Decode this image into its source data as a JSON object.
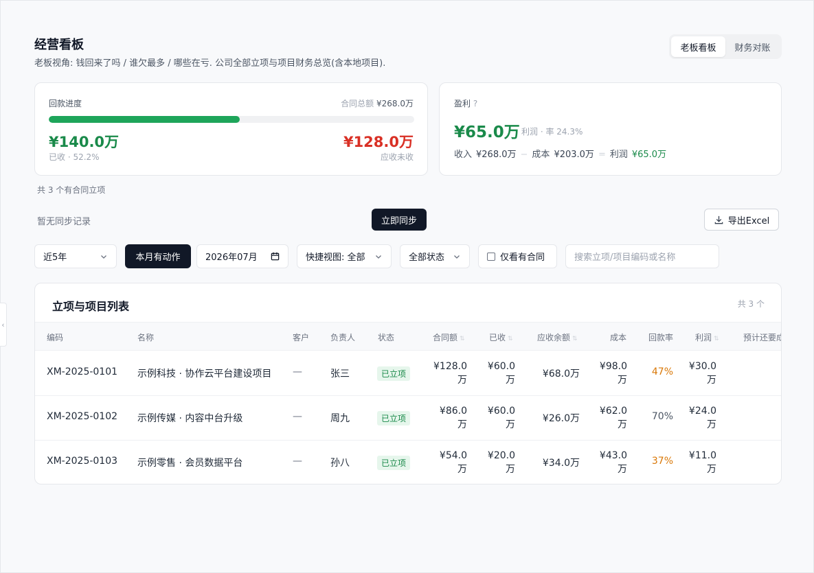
{
  "header": {
    "title": "经营看板",
    "subtitle": "老板视角: 钱回来了吗 / 谁欠最多 / 哪些在亏. 公司全部立项与项目财务总览(含本地项目).",
    "views": [
      "老板看板",
      "财务对账"
    ],
    "active_view": "老板看板"
  },
  "collection": {
    "label": "回款进度",
    "contract_total_label": "合同总额",
    "contract_total": "¥268.0万",
    "progress_fraction": 0.522,
    "received": "¥140.0万",
    "received_note": "已收 · 52.2%",
    "outstanding": "¥128.0万",
    "outstanding_note": "应收未收"
  },
  "profit": {
    "label": "盈利",
    "help": "?",
    "value": "¥65.0万",
    "rate_note": "利润 · 率 24.3%",
    "revenue_label": "收入",
    "revenue": "¥268.0万",
    "op_minus": "−",
    "cost_label": "成本",
    "cost": "¥203.0万",
    "op_equals": "=",
    "profit_label": "利润",
    "profit": "¥65.0万"
  },
  "project_count_note": "共 3 个有合同立项",
  "sync": {
    "status": "暂无同步记录",
    "sync_button": "立即同步",
    "export_button": "导出Excel"
  },
  "filters": {
    "years": "近5年",
    "month_action": "本月有动作",
    "date": "2026年07月",
    "quick_view": "快捷视图: 全部",
    "status": "全部状态",
    "contract_only": "仅看有合同",
    "search_placeholder": "搜索立项/项目编码或名称"
  },
  "table": {
    "title": "立项与项目列表",
    "total": "共 3 个",
    "columns": [
      "编码",
      "名称",
      "客户",
      "负责人",
      "状态",
      "合同额",
      "已收",
      "应收余额",
      "成本",
      "回款率",
      "利润",
      "预计还要成"
    ],
    "rows": [
      {
        "code": "XM-2025-0101",
        "name": "示例科技 · 协作云平台建设项目",
        "customer": "—",
        "owner": "张三",
        "status": "已立项",
        "contract_1": "¥128.0",
        "contract_2": "万",
        "received_1": "¥60.0",
        "received_2": "万",
        "balance": "¥68.0万",
        "cost_1": "¥98.0",
        "cost_2": "万",
        "rate": "47%",
        "rate_warn": true,
        "profit_1": "¥30.0",
        "profit_2": "万"
      },
      {
        "code": "XM-2025-0102",
        "name": "示例传媒 · 内容中台升级",
        "customer": "—",
        "owner": "周九",
        "status": "已立项",
        "contract_1": "¥86.0",
        "contract_2": "万",
        "received_1": "¥60.0",
        "received_2": "万",
        "balance": "¥26.0万",
        "cost_1": "¥62.0",
        "cost_2": "万",
        "rate": "70%",
        "rate_warn": false,
        "profit_1": "¥24.0",
        "profit_2": "万"
      },
      {
        "code": "XM-2025-0103",
        "name": "示例零售 · 会员数据平台",
        "customer": "—",
        "owner": "孙八",
        "status": "已立项",
        "contract_1": "¥54.0",
        "contract_2": "万",
        "received_1": "¥20.0",
        "received_2": "万",
        "balance": "¥34.0万",
        "cost_1": "¥43.0",
        "cost_2": "万",
        "rate": "37%",
        "rate_warn": true,
        "profit_1": "¥11.0",
        "profit_2": "万"
      }
    ]
  }
}
